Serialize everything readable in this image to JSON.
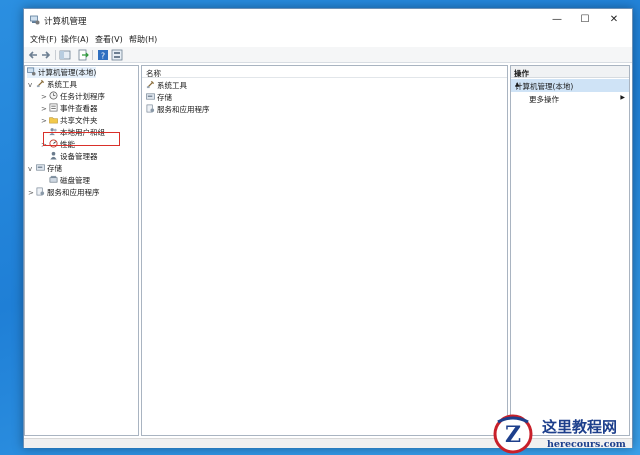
{
  "window": {
    "title": "计算机管理"
  },
  "window_controls": {
    "minimize": "—",
    "maximize": "☐",
    "close": "✕"
  },
  "menu": [
    "文件(F)",
    "操作(A)",
    "查看(V)",
    "帮助(H)"
  ],
  "tree": [
    {
      "label": "计算机管理(本地)",
      "icon": "computer-management-icon",
      "chevron": ""
    },
    {
      "label": "系统工具",
      "icon": "system-tools-icon",
      "chevron": "v"
    },
    {
      "label": "任务计划程序",
      "icon": "clock-icon",
      "chevron": ">"
    },
    {
      "label": "事件查看器",
      "icon": "event-viewer-icon",
      "chevron": ">"
    },
    {
      "label": "共享文件夹",
      "icon": "shared-folder-icon",
      "chevron": ">"
    },
    {
      "label": "本地用户和组",
      "icon": "users-icon",
      "chevron": ">"
    },
    {
      "label": "性能",
      "icon": "performance-icon",
      "chevron": ">"
    },
    {
      "label": "设备管理器",
      "icon": "device-manager-icon",
      "chevron": ""
    },
    {
      "label": "存储",
      "icon": "storage-icon",
      "chevron": "v"
    },
    {
      "label": "磁盘管理",
      "icon": "disk-icon",
      "chevron": ""
    },
    {
      "label": "服务和应用程序",
      "icon": "services-icon",
      "chevron": ">"
    }
  ],
  "list": {
    "header": "名称",
    "items": [
      "系统工具",
      "存储",
      "服务和应用程序"
    ]
  },
  "actions": {
    "header": "操作",
    "section": "计算机管理(本地)",
    "section_toggle": "▲",
    "item": "更多操作",
    "item_arrow": "▶"
  },
  "watermark": {
    "title": "这里教程网",
    "url": "herecours.com"
  },
  "colors": {
    "accent": "#cfe3f6",
    "highlight_border": "#d9302a",
    "desktop": "#2b8fe0"
  }
}
